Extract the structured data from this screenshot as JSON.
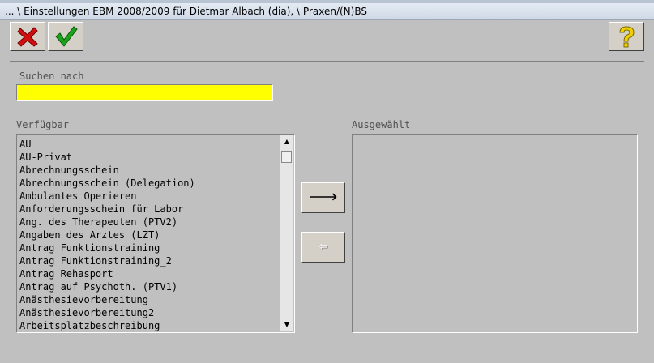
{
  "window": {
    "title": "... \\ Einstellungen EBM 2008/2009 für Dietmar Albach (dia),  \\ Praxen/(N)BS"
  },
  "toolbar": {
    "cancel_icon": "red-x-icon",
    "ok_icon": "green-check-icon",
    "help_icon": "yellow-question-icon"
  },
  "search": {
    "label": "Suchen nach",
    "value": ""
  },
  "available": {
    "label": "Verfügbar",
    "items": [
      "AU",
      "AU-Privat",
      "Abrechnungsschein",
      "Abrechnungsschein (Delegation)",
      "Ambulantes Operieren",
      "Anforderungsschein für Labor",
      "Ang. des Therapeuten (PTV2)",
      "Angaben des Arztes (LZT)",
      "Antrag Funktionstraining",
      "Antrag Funktionstraining_2",
      "Antrag Rehasport",
      "Antrag auf Psychoth. (PTV1)",
      "Anästhesievorbereitung",
      "Anästhesievorbereitung2",
      "Arbeitsplatzbeschreibung"
    ]
  },
  "selected": {
    "label": "Ausgewählt",
    "items": []
  },
  "buttons": {
    "add_glyph": "🡒",
    "remove_glyph": "⇦"
  },
  "colors": {
    "search_bg": "#ffff00",
    "window_bg": "#c0c0c0"
  }
}
